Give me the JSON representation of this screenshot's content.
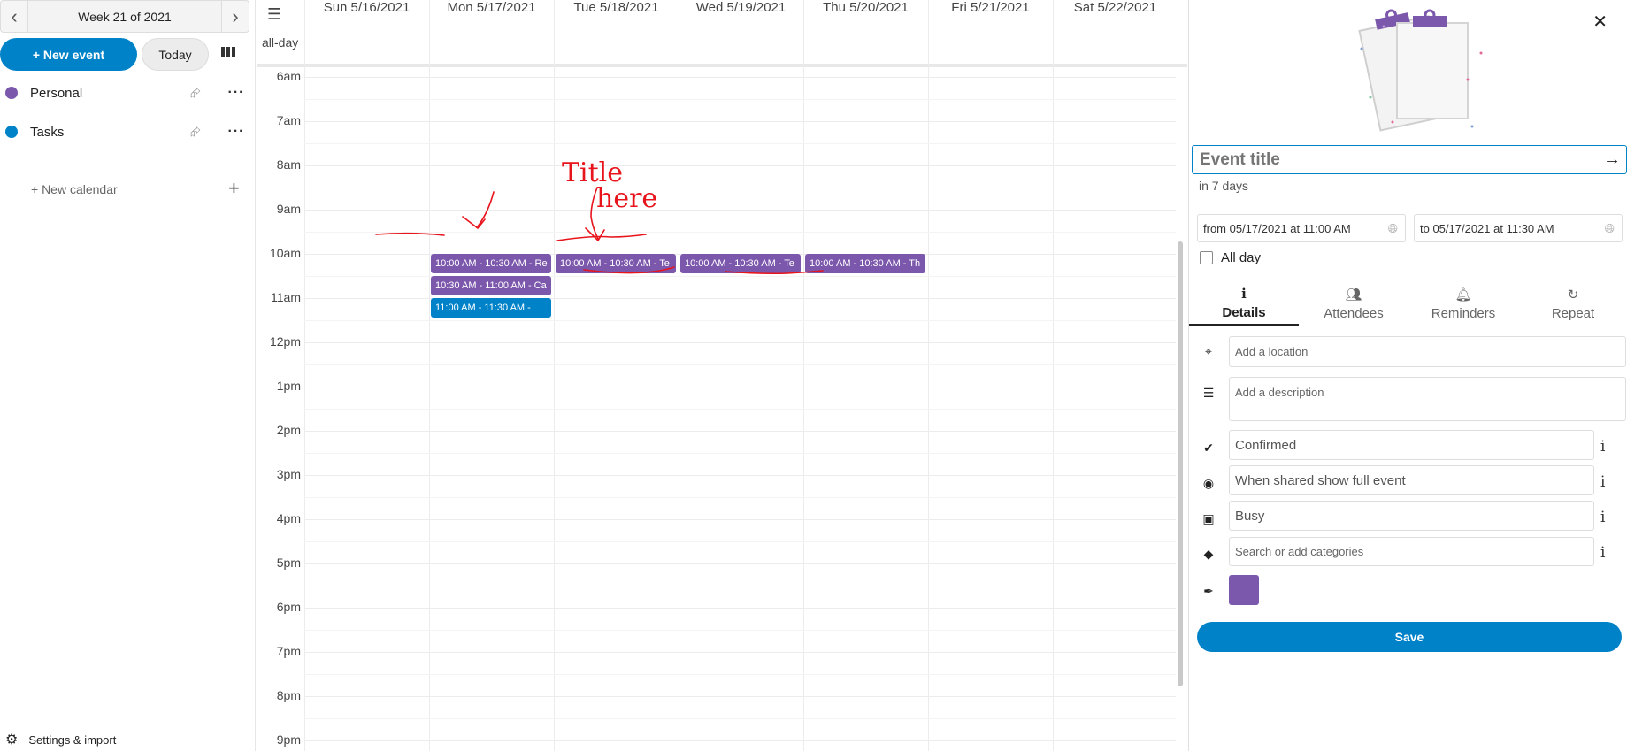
{
  "sidebar": {
    "week_label": "Week 21 of 2021",
    "prev_icon": "chevron-left-icon",
    "next_icon": "chevron-right-icon",
    "new_event_label": "+ New event",
    "today_label": "Today",
    "calendars": [
      {
        "name": "Personal",
        "color": "#7c58ac"
      },
      {
        "name": "Tasks",
        "color": "#0082c9"
      }
    ],
    "new_calendar_label": "+ New calendar",
    "settings_label": "Settings & import"
  },
  "grid": {
    "days": [
      "Sun 5/16/2021",
      "Mon 5/17/2021",
      "Tue 5/18/2021",
      "Wed 5/19/2021",
      "Thu 5/20/2021",
      "Fri 5/21/2021",
      "Sat 5/22/2021"
    ],
    "all_day_label": "all-day",
    "hours": [
      "6am",
      "7am",
      "8am",
      "9am",
      "10am",
      "11am",
      "12pm",
      "1pm",
      "2pm",
      "3pm",
      "4pm",
      "5pm",
      "6pm",
      "7pm",
      "8pm",
      "9pm"
    ],
    "events": [
      {
        "text": "10:00 AM - 10:30 AM - Re",
        "day": 1,
        "color": "#7c58ac"
      },
      {
        "text": "10:30 AM - 11:00 AM - Ca",
        "day": 1,
        "color": "#7c58ac"
      },
      {
        "text": "11:00 AM - 11:30 AM -",
        "day": 1,
        "color": "#0082c9"
      },
      {
        "text": "10:00 AM - 10:30 AM - Te",
        "day": 2,
        "color": "#7c58ac"
      },
      {
        "text": "10:00 AM - 10:30 AM - Te",
        "day": 3,
        "color": "#7c58ac"
      },
      {
        "text": "10:00 AM - 10:30 AM - Th",
        "day": 4,
        "color": "#7c58ac"
      }
    ],
    "annotation_text": [
      "Title",
      "here"
    ],
    "annotation_color": "#e8141c"
  },
  "panel": {
    "title_placeholder": "Event title",
    "relative_time": "in 7 days",
    "from_label": "from 05/17/2021 at 11:00 AM",
    "to_label": "to 05/17/2021 at 11:30 AM",
    "all_day_label": "All day",
    "tabs": [
      {
        "label": "Details",
        "icon": "info-icon"
      },
      {
        "label": "Attendees",
        "icon": "people-icon"
      },
      {
        "label": "Reminders",
        "icon": "bell-icon"
      },
      {
        "label": "Repeat",
        "icon": "repeat-icon"
      }
    ],
    "location_placeholder": "Add a location",
    "description_placeholder": "Add a description",
    "status_value": "Confirmed",
    "visibility_value": "When shared show full event",
    "availability_value": "Busy",
    "categories_placeholder": "Search or add categories",
    "color": "#7c58ac",
    "save_label": "Save"
  }
}
